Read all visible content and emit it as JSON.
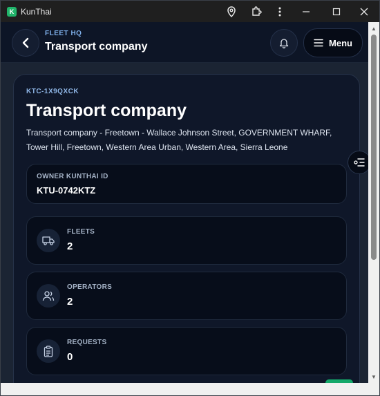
{
  "window": {
    "title": "KunThai",
    "logo_letter": "K"
  },
  "header": {
    "subtitle": "FLEET HQ",
    "title": "Transport company",
    "menu_label": "Menu"
  },
  "company": {
    "code": "KTC-1X9QXCK",
    "name": "Transport company",
    "address": "Transport company - Freetown - Wallace Johnson Street, GOVERNMENT WHARF, Tower Hill, Freetown, Western Area Urban, Western Area, Sierra Leone"
  },
  "owner": {
    "label": "OWNER KUNTHAI ID",
    "value": "KTU-0742KTZ"
  },
  "stats": [
    {
      "label": "FLEETS",
      "value": "2",
      "icon": "truck-icon"
    },
    {
      "label": "OPERATORS",
      "value": "2",
      "icon": "users-icon"
    },
    {
      "label": "REQUESTS",
      "value": "0",
      "icon": "clipboard-icon"
    }
  ],
  "colors": {
    "accent": "#20b46a",
    "background": "#0e1526",
    "card": "#0f1729",
    "label_blue": "#8fb6e6"
  }
}
